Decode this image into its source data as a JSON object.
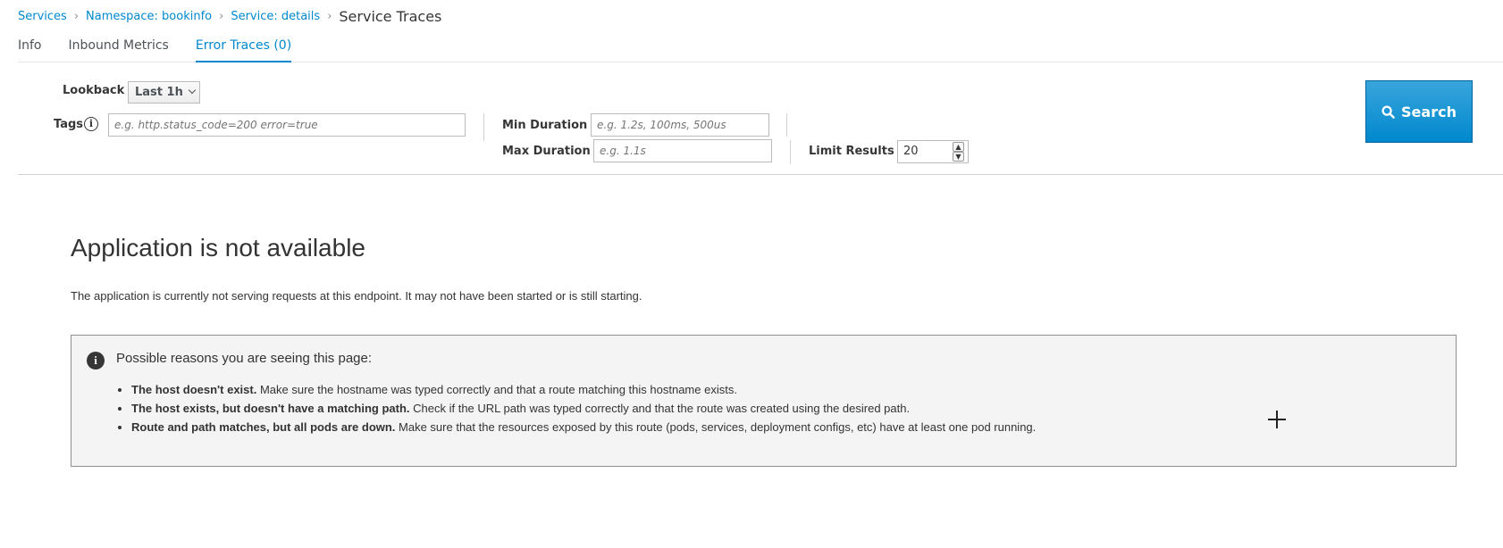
{
  "breadcrumb": {
    "services": "Services",
    "namespace": "Namespace: bookinfo",
    "service": "Service: details",
    "current": "Service Traces",
    "separator": "›"
  },
  "tabs": [
    {
      "label": "Info",
      "active": false
    },
    {
      "label": "Inbound Metrics",
      "active": false
    },
    {
      "label": "Error Traces (0)",
      "active": true
    }
  ],
  "toolbar": {
    "lookback_label": "Lookback",
    "lookback_value": "Last 1h",
    "tags_label": "Tags",
    "tags_placeholder": "e.g. http.status_code=200 error=true",
    "min_duration_label": "Min Duration",
    "min_duration_placeholder": "e.g. 1.2s, 100ms, 500us",
    "max_duration_label": "Max Duration",
    "max_duration_placeholder": "e.g. 1.1s",
    "limit_label": "Limit Results",
    "limit_value": "20",
    "search_label": "Search"
  },
  "error_page": {
    "title": "Application is not available",
    "description": "The application is currently not serving requests at this endpoint. It may not have been started or is still starting.",
    "reasons_heading": "Possible reasons you are seeing this page:",
    "reasons": [
      {
        "bold": "The host doesn't exist.",
        "text": " Make sure the hostname was typed correctly and that a route matching this hostname exists."
      },
      {
        "bold": "The host exists, but doesn't have a matching path.",
        "text": " Check if the URL path was typed correctly and that the route was created using the desired path."
      },
      {
        "bold": "Route and path matches, but all pods are down.",
        "text": " Make sure that the resources exposed by this route (pods, services, deployment configs, etc) have at least one pod running."
      }
    ]
  },
  "colors": {
    "link": "#0088ce",
    "primary_button": "#0088ce",
    "text": "#363636"
  },
  "icons": {
    "tags_info": "info-circle-icon",
    "search": "search-icon",
    "reasons_info": "info-icon",
    "cursor": "crosshair-cursor-icon"
  }
}
